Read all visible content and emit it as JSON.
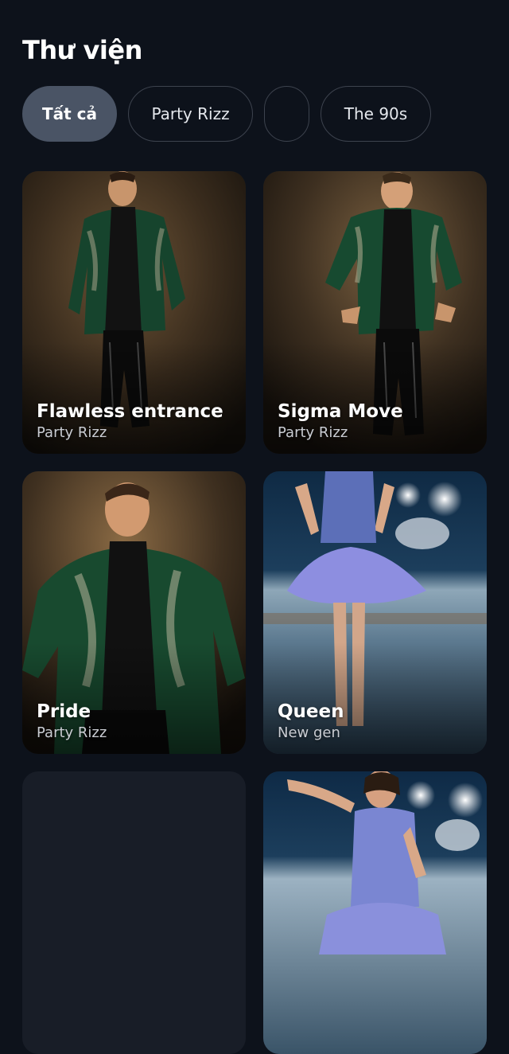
{
  "header": {
    "title": "Thư viện"
  },
  "tabs": [
    {
      "label": "Tất cả",
      "active": true
    },
    {
      "label": "Party Rizz",
      "active": false
    },
    {
      "label": "",
      "active": false
    },
    {
      "label": "The 90s",
      "active": false
    }
  ],
  "cards": [
    {
      "title": "Flawless entrance",
      "subtitle": "Party Rizz"
    },
    {
      "title": "Sigma Move",
      "subtitle": "Party Rizz"
    },
    {
      "title": "Pride",
      "subtitle": "Party Rizz"
    },
    {
      "title": "Queen",
      "subtitle": "New gen"
    },
    {
      "title": "",
      "subtitle": ""
    },
    {
      "title": "",
      "subtitle": ""
    }
  ],
  "colors": {
    "background": "#0d121b",
    "tab_active": "#4a5465",
    "tab_border": "#3d434e",
    "card_placeholder": "#171c26"
  }
}
